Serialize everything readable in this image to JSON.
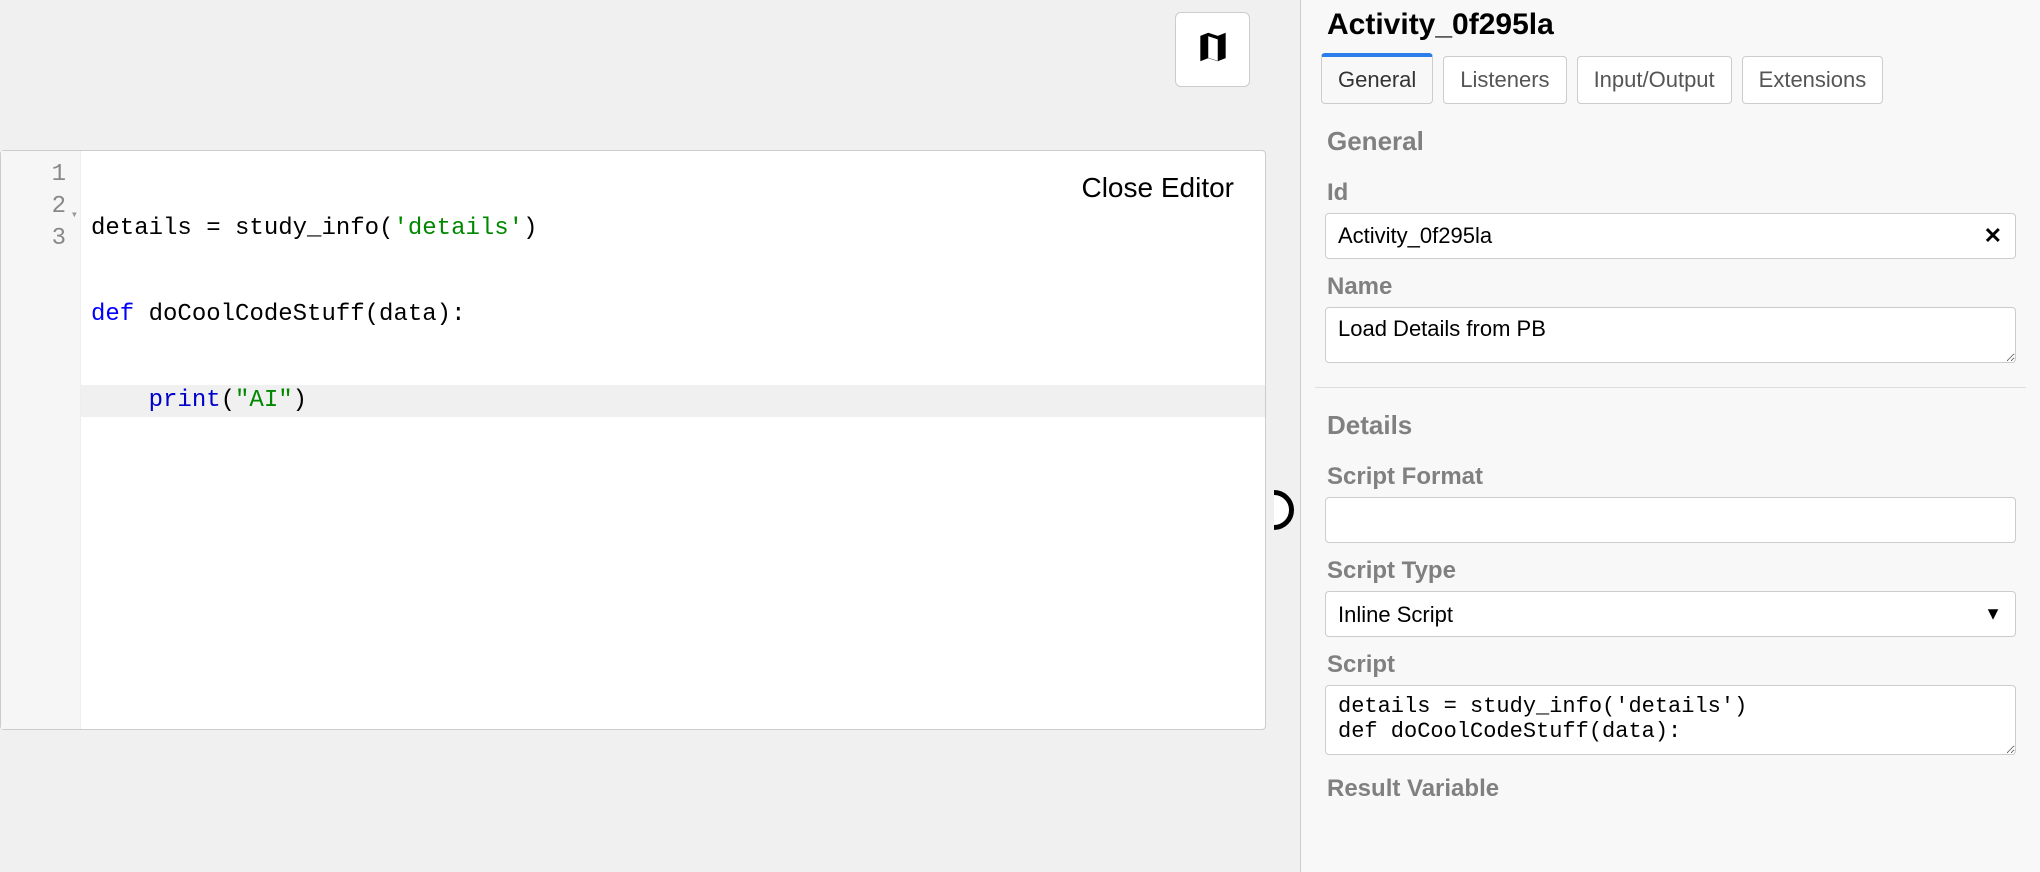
{
  "editor": {
    "close_label": "Close Editor",
    "lines": [
      {
        "n": 1,
        "fold": false
      },
      {
        "n": 2,
        "fold": true
      },
      {
        "n": 3,
        "fold": false
      }
    ],
    "code_line1_plain": "details = study_info(",
    "code_line1_str": "'details'",
    "code_line1_end": ")",
    "code_line2_kw": "def",
    "code_line2_fn": " doCoolCodeStuff(data):",
    "code_line3_indent": "    ",
    "code_line3_builtin": "print",
    "code_line3_open": "(",
    "code_line3_str": "\"AI\"",
    "code_line3_close": ")"
  },
  "panel": {
    "title": "Activity_0f295la",
    "tabs": [
      {
        "label": "General",
        "active": true
      },
      {
        "label": "Listeners",
        "active": false
      },
      {
        "label": "Input/Output",
        "active": false
      },
      {
        "label": "Extensions",
        "active": false
      }
    ],
    "section_general": "General",
    "field_id_label": "Id",
    "field_id_value": "Activity_0f295la",
    "field_name_label": "Name",
    "field_name_value": "Load Details from PB",
    "section_details": "Details",
    "field_script_format_label": "Script Format",
    "field_script_format_value": "",
    "field_script_type_label": "Script Type",
    "field_script_type_value": "Inline Script",
    "field_script_label": "Script",
    "field_script_value": "details = study_info('details')\ndef doCoolCodeStuff(data):",
    "cutoff_label": "Result Variable"
  }
}
